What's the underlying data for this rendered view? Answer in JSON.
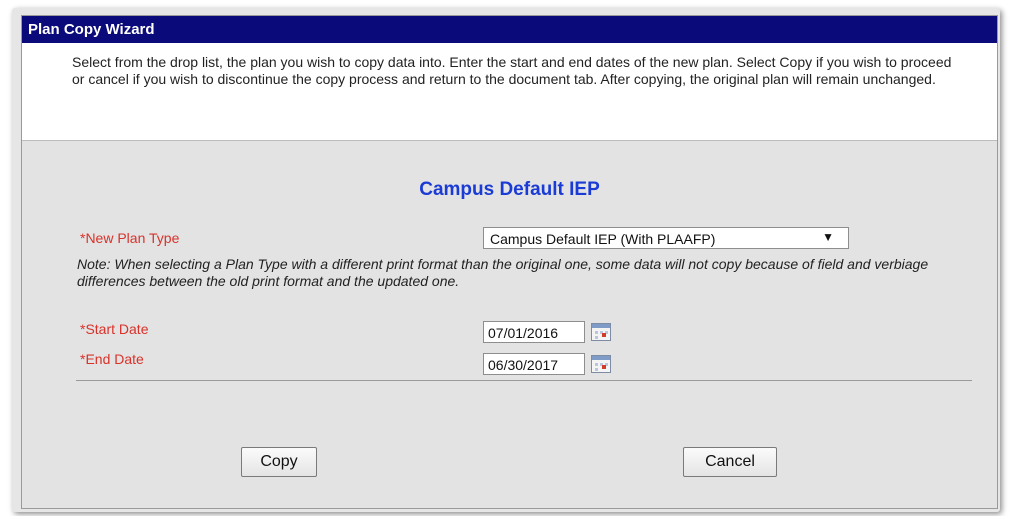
{
  "window": {
    "title": "Plan Copy Wizard"
  },
  "instructions": "Select from the drop list, the plan you wish to copy data into. Enter the start and end dates of the new plan. Select Copy if you wish to proceed or cancel if you wish to discontinue the copy process and return to the document tab. After copying, the original plan will remain unchanged.",
  "form": {
    "heading": "Campus Default IEP",
    "plan_type": {
      "label": "*New Plan Type",
      "selected": "Campus Default IEP (With PLAAFP)",
      "arrow": "▼"
    },
    "note": "Note: When selecting a Plan Type with a different print format than the original one, some data will not copy because of field and verbiage differences between the old print format and the updated one.",
    "start_date": {
      "label": "*Start Date",
      "value": "07/01/2016"
    },
    "end_date": {
      "label": "*End Date",
      "value": "06/30/2017"
    }
  },
  "buttons": {
    "copy": "Copy",
    "cancel": "Cancel"
  },
  "colors": {
    "titlebar": "#0a0a7a",
    "heading": "#1a3bd4",
    "required_label": "#d8322a",
    "panel": "#e3e3e3"
  }
}
